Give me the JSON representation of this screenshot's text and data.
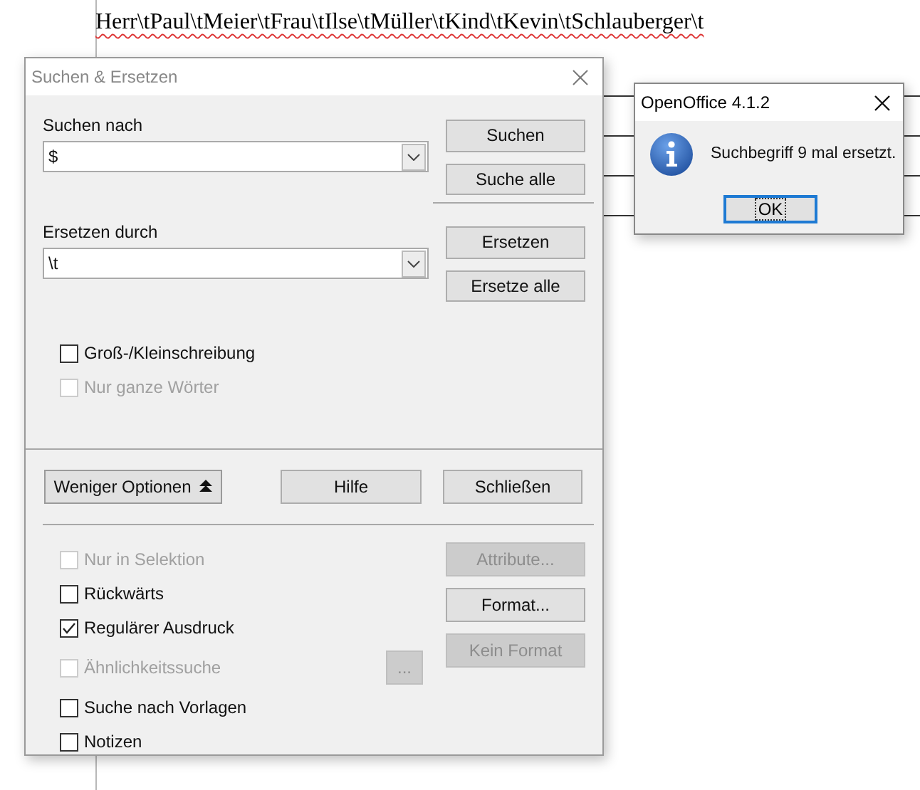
{
  "document": {
    "text": "Herr\\tPaul\\tMeier\\tFrau\\tIlse\\tMüller\\tKind\\tKevin\\tSchlauberger\\t"
  },
  "dialog": {
    "title": "Suchen & Ersetzen",
    "search": {
      "label": "Suchen nach",
      "value": "$"
    },
    "replace": {
      "label": "Ersetzen durch",
      "value": "\\t"
    },
    "search_buttons": [
      {
        "label": "Suchen",
        "disabled": false
      },
      {
        "label": "Suche alle",
        "disabled": false
      }
    ],
    "replace_buttons": [
      {
        "label": "Ersetzen",
        "disabled": false
      },
      {
        "label": "Ersetze alle",
        "disabled": false
      }
    ],
    "match_options": [
      {
        "label": "Groß-/Kleinschreibung",
        "checked": false,
        "disabled": false
      },
      {
        "label": "Nur ganze Wörter",
        "checked": false,
        "disabled": true
      }
    ],
    "less_options_button": "Weniger Optionen",
    "help_button": "Hilfe",
    "close_button": "Schließen",
    "more_options": [
      {
        "label": "Nur in Selektion",
        "checked": false,
        "disabled": true
      },
      {
        "label": "Rückwärts",
        "checked": false,
        "disabled": false
      },
      {
        "label": "Regulärer Ausdruck",
        "checked": true,
        "disabled": false
      },
      {
        "label": "Ähnlichkeitssuche",
        "checked": false,
        "disabled": true
      },
      {
        "label": "Suche nach Vorlagen",
        "checked": false,
        "disabled": false
      },
      {
        "label": "Notizen",
        "checked": false,
        "disabled": false
      }
    ],
    "similarity_button": {
      "label": "...",
      "disabled": true
    },
    "format_buttons": [
      {
        "label": "Attribute...",
        "disabled": true
      },
      {
        "label": "Format...",
        "disabled": false
      },
      {
        "label": "Kein Format",
        "disabled": true
      }
    ]
  },
  "message_box": {
    "title": "OpenOffice 4.1.2",
    "message": "Suchbegriff 9 mal ersetzt.",
    "ok": "OK"
  }
}
